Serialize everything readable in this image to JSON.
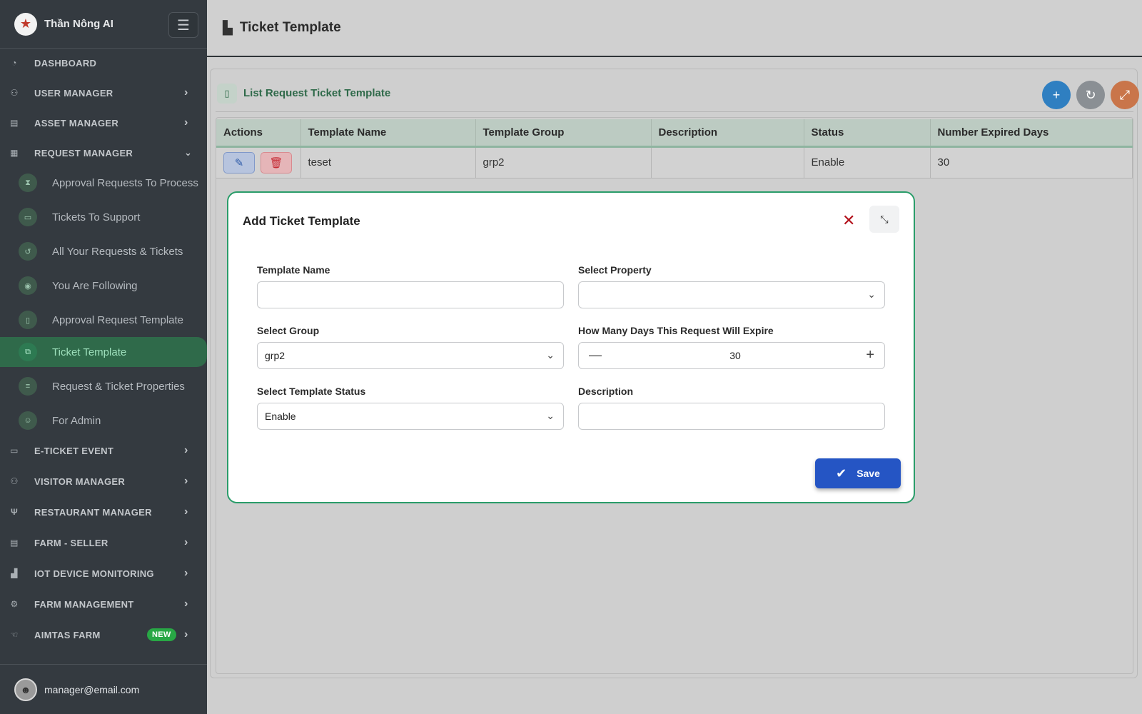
{
  "app": {
    "brand": "Thần Nông AI",
    "user_email": "manager@email.com"
  },
  "header": {
    "title": "Ticket Template"
  },
  "sidebar": {
    "items": [
      {
        "label": "DASHBOARD",
        "icon": "dashboard-icon"
      },
      {
        "label": "USER MANAGER",
        "icon": "users-icon"
      },
      {
        "label": "ASSET MANAGER",
        "icon": "asset-icon"
      },
      {
        "label": "REQUEST MANAGER",
        "icon": "clipboard-icon"
      },
      {
        "label": "E-TICKET EVENT",
        "icon": "ticket-icon"
      },
      {
        "label": "VISITOR MANAGER",
        "icon": "visitor-icon"
      },
      {
        "label": "RESTAURANT MANAGER",
        "icon": "restaurant-icon"
      },
      {
        "label": "FARM - SELLER",
        "icon": "store-icon"
      },
      {
        "label": "IOT DEVICE MONITORING",
        "icon": "factory-icon"
      },
      {
        "label": "FARM MANAGEMENT",
        "icon": "tractor-icon"
      },
      {
        "label": "AIMTAS FARM",
        "icon": "hand-icon",
        "badge": "NEW"
      }
    ],
    "request_sub": [
      {
        "label": "Approval Requests To Process",
        "icon": "hourglass-icon"
      },
      {
        "label": "Tickets To Support",
        "icon": "ticket-icon"
      },
      {
        "label": "All Your Requests & Tickets",
        "icon": "history-icon"
      },
      {
        "label": "You Are Following",
        "icon": "eye-icon"
      },
      {
        "label": "Approval Request Template",
        "icon": "document-icon"
      },
      {
        "label": "Ticket Template",
        "icon": "copy-icon"
      },
      {
        "label": "Request & Ticket Properties",
        "icon": "sliders-icon"
      },
      {
        "label": "For Admin",
        "icon": "admin-icon"
      }
    ]
  },
  "card": {
    "title": "List Request Ticket Template"
  },
  "table": {
    "columns": [
      "Actions",
      "Template Name",
      "Template Group",
      "Description",
      "Status",
      "Number Expired Days"
    ],
    "rows": [
      {
        "template_name": "teset",
        "template_group": "grp2",
        "description": "",
        "status": "Enable",
        "expired_days": "30"
      }
    ]
  },
  "modal": {
    "title": "Add Ticket Template",
    "template_name_label": "Template Name",
    "template_name_value": "",
    "property_label": "Select Property",
    "property_value": "",
    "group_label": "Select Group",
    "group_value": "grp2",
    "days_label": "How Many Days This Request Will Expire",
    "days_value": "30",
    "status_label": "Select Template Status",
    "status_value": "Enable",
    "description_label": "Description",
    "description_value": "",
    "save_label": "Save"
  },
  "colors": {
    "sidebar_bg": "#343a40",
    "accent_green": "#2a9d6a",
    "save_blue": "#2555c4",
    "delete_red": "#c62b35"
  }
}
